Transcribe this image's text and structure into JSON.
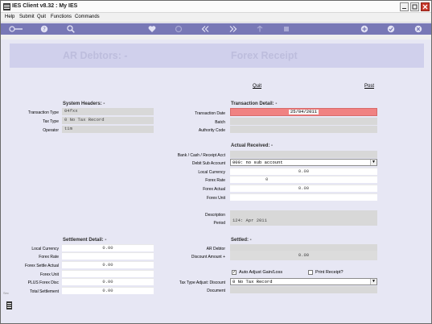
{
  "app": {
    "title": "IES Client v8.32 : My IES"
  },
  "menu": [
    "Help",
    "Submit",
    "Quit",
    "Functions",
    "Commands"
  ],
  "toolbar_icons": [
    "key-icon",
    "help-icon",
    "search-icon",
    "heart-icon",
    "refresh-icon",
    "rewind-icon",
    "fast-forward-icon",
    "upload-icon",
    "stop-icon",
    "add-icon",
    "check-icon",
    "close-icon"
  ],
  "banner": {
    "left_title": "AR Debtors: -",
    "right_title": "Forex Receipt"
  },
  "actions": {
    "quit": "Quit",
    "post": "Post"
  },
  "system_headers": {
    "title": "System Headers: -",
    "fields": [
      {
        "label": "Transaction Type",
        "value": "04fxx"
      },
      {
        "label": "Tax Type",
        "value": "0 No Tax Record"
      },
      {
        "label": "Operator",
        "value": "tim"
      }
    ]
  },
  "transaction_detail": {
    "title": "Transaction Detail: -",
    "date_label": "Transaction Date",
    "date_value": "25/04/2011",
    "batch_label": "Batch",
    "batch_value": "",
    "authority_label": "Authority Code",
    "authority_value": ""
  },
  "actual_received": {
    "title": "Actual Received: -",
    "fields": [
      {
        "label": "Bank / Cash / Receipt Acct",
        "value": ""
      },
      {
        "label": "Debit Sub Account",
        "value": "000: no sub account"
      },
      {
        "label": "Local Currency",
        "value": "0.00"
      },
      {
        "label": "Forex Rate",
        "value": "0"
      },
      {
        "label": "Forex Actual",
        "value": "0.00"
      },
      {
        "label": "Forex Unit",
        "value": ""
      }
    ],
    "description_label": "Description",
    "description_value": "",
    "period_label": "Period",
    "period_value": "124: Apr 2011"
  },
  "settlement_detail": {
    "title": "Settlement Detail: -",
    "fields": [
      {
        "label": "Local Currency",
        "value": "0.00"
      },
      {
        "label": "Forex Rate",
        "value": ""
      },
      {
        "label": "Forex Settle Actual",
        "value": "0.00"
      },
      {
        "label": "Forex Unit",
        "value": ""
      },
      {
        "label": "PLUS Forex Disc",
        "value": "0.00"
      },
      {
        "label": "Total Settlement",
        "value": "0.00"
      }
    ]
  },
  "settled": {
    "title": "Settled: -",
    "ar_debtor_label": "AR Debtor",
    "ar_debtor_value": "",
    "discount_label": "Discount Amount +",
    "discount_value": "0.00",
    "auto_adjust_label": "Auto Adjust Gain/Loss",
    "auto_adjust_checked": true,
    "print_receipt_label": "Print Receipt?",
    "print_receipt_checked": false,
    "tax_adjust_label": "Tax Type Adjust: Discount",
    "tax_adjust_value": "0 No Tax Record",
    "document_label": "Document",
    "document_value": ""
  },
  "side_tab": "Sec",
  "colors": {
    "toolbar": "#7878b6",
    "background": "#e7e7f4",
    "banner": "#d0d0ec",
    "highlight": "#f08282"
  }
}
